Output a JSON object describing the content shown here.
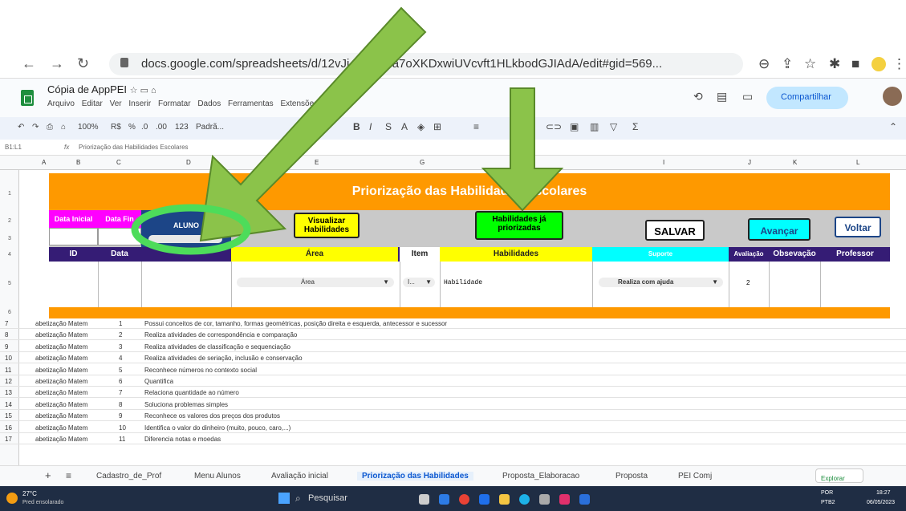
{
  "browser": {
    "url": "docs.google.com/spreadsheets/d/12vJi...xb8h6a7oXKDxwiUVcvft1HLkbodGJIAdA/edit#gid=569..."
  },
  "doc": {
    "title": "Cópia de AppPEI",
    "menus": [
      "Arquivo",
      "Editar",
      "Ver",
      "Inserir",
      "Formatar",
      "Dados",
      "Ferramentas",
      "Extensões",
      "Ajuda"
    ],
    "share_label": "Compartilhar",
    "zoom": "100%",
    "currency": "R$",
    "pct": "%",
    "dec1": ".0",
    "dec2": ".00",
    "fmt": "123",
    "font": "Padrã...",
    "cell_ref": "B1:L1",
    "formula": "Priorização das Habilidades Escolares"
  },
  "columns": [
    "A",
    "B",
    "C",
    "D",
    "E",
    "G",
    "I",
    "J",
    "K",
    "L"
  ],
  "sheet": {
    "title": "Priorização das Habilidades Escolares",
    "data_inicial": "Data Inicial",
    "data_final": "Data Fin",
    "aluno_label": "ALUNO",
    "visualizar": "Visualizar Habilidades",
    "habilidades_ja": "Habilidades já priorizadas",
    "salvar": "SALVAR",
    "avancar": "Avançar",
    "voltar": "Voltar",
    "headers": [
      "ID",
      "Data",
      "Área",
      "Item",
      "Habilidades",
      "Suporte",
      "Avaliação",
      "Obsevação",
      "Professor"
    ],
    "area_value": "Área",
    "item_value": "I...",
    "habilidade_value": "Habilidade",
    "suporte_value": "Realiza com ajuda",
    "avaliacao_value": "2"
  },
  "rows": [
    {
      "n": "7",
      "area": "abetização Matem",
      "id": "1",
      "hab": "Possui conceitos de cor, tamanho, formas geométricas, posição direita e esquerda, antecessor e sucessor"
    },
    {
      "n": "8",
      "area": "abetização Matem",
      "id": "2",
      "hab": "Realiza atividades de correspondência e comparação"
    },
    {
      "n": "9",
      "area": "abetização Matem",
      "id": "3",
      "hab": "Realiza atividades de classificação e sequenciação"
    },
    {
      "n": "10",
      "area": "abetização Matem",
      "id": "4",
      "hab": "Realiza atividades de seriação, inclusão e conservação"
    },
    {
      "n": "11",
      "area": "abetização Matem",
      "id": "5",
      "hab": "Reconhece números no contexto social"
    },
    {
      "n": "12",
      "area": "abetização Matem",
      "id": "6",
      "hab": "Quantifica"
    },
    {
      "n": "13",
      "area": "abetização Matem",
      "id": "7",
      "hab": "Relaciona quantidade ao número"
    },
    {
      "n": "14",
      "area": "abetização Matem",
      "id": "8",
      "hab": "Soluciona problemas simples"
    },
    {
      "n": "15",
      "area": "abetização Matem",
      "id": "9",
      "hab": "Reconhece os valores dos preços dos produtos"
    },
    {
      "n": "16",
      "area": "abetização Matem",
      "id": "10",
      "hab": "Identifica o valor do dinheiro (muito, pouco, caro,...)"
    },
    {
      "n": "17",
      "area": "abetização Matem",
      "id": "11",
      "hab": "Diferencia notas e moedas"
    }
  ],
  "tabs": [
    "Cadastro_de_Prof",
    "Menu Alunos",
    "Avaliação inicial",
    "Priorização das Habilidades",
    "Proposta_Elaboracao",
    "Proposta",
    "PEI Comj"
  ],
  "explore": "Explorar",
  "taskbar": {
    "weather_temp": "27°C",
    "weather_desc": "Pred ensolarado",
    "search": "Pesquisar",
    "lang1": "POR",
    "lang2": "PTB2",
    "time": "18:27",
    "date": "06/05/2023"
  },
  "colors": {
    "orange": "#fe9900",
    "purple": "#351c75",
    "yellow": "#ffff00",
    "green": "#00ff00",
    "cyan": "#00ffff",
    "pink": "#ff00ff"
  }
}
